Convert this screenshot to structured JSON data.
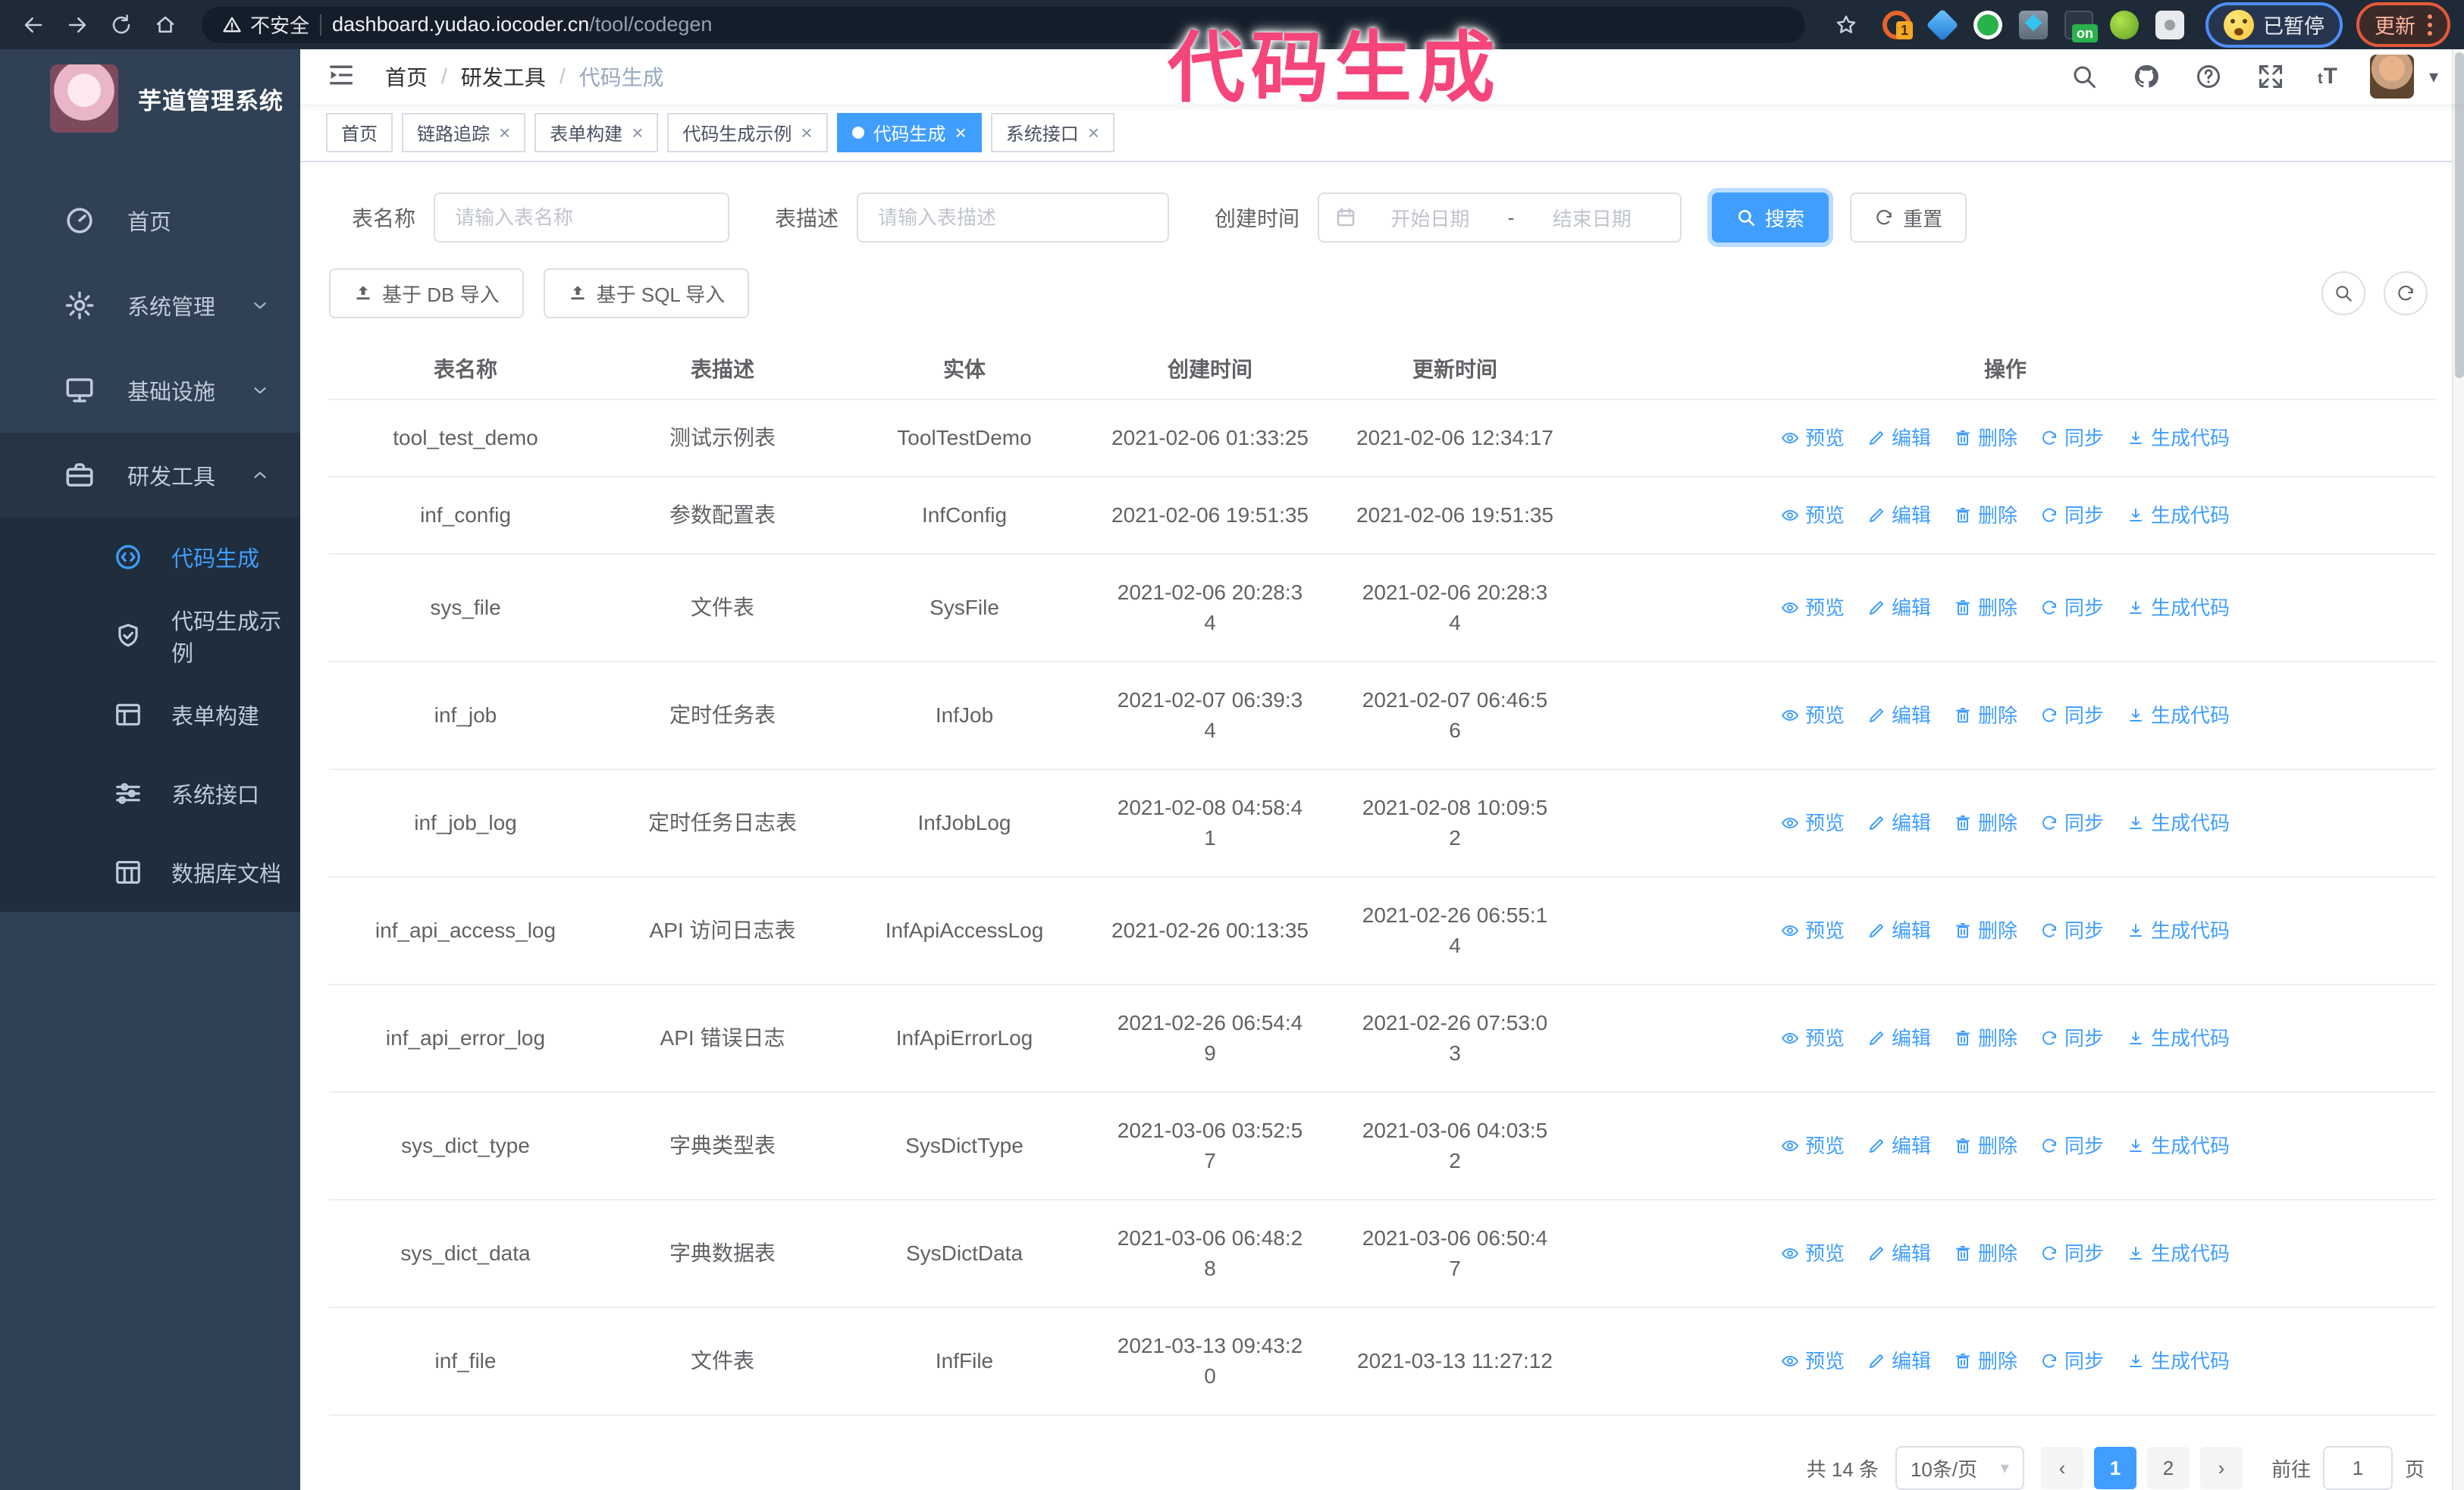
{
  "colors": {
    "accent": "#409eff",
    "sidebar_bg": "#304156",
    "submenu_bg": "#1f2d3d",
    "active_tab_bg": "#409eff",
    "watermark_pink": "#f5457a",
    "browser_bar_bg": "#1f2a38"
  },
  "watermark": "代码生成",
  "browser": {
    "security_warning": "不安全",
    "url_host": "dashboard.yudao.iocoder.cn",
    "url_path": "/tool/codegen",
    "paused_badge": "已暂停",
    "update_button": "更新",
    "extensions": [
      {
        "name": "extension-orange",
        "badge": "1"
      },
      {
        "name": "extension-gem",
        "badge": ""
      },
      {
        "name": "extension-shield",
        "badge": ""
      },
      {
        "name": "extension-panels",
        "badge": ""
      },
      {
        "name": "extension-dark",
        "badge": "on"
      },
      {
        "name": "extension-key",
        "badge": ""
      },
      {
        "name": "extension-puzzle",
        "badge": ""
      }
    ]
  },
  "sidebar": {
    "title": "芋道管理系统",
    "items": [
      {
        "label": "首页",
        "icon": "dashboard",
        "chevron": ""
      },
      {
        "label": "系统管理",
        "icon": "gear",
        "chevron": "down"
      },
      {
        "label": "基础设施",
        "icon": "monitor",
        "chevron": "down"
      },
      {
        "label": "研发工具",
        "icon": "toolbox",
        "chevron": "up",
        "open": true
      }
    ],
    "submenu": [
      {
        "label": "代码生成",
        "icon": "code",
        "active": true
      },
      {
        "label": "代码生成示例",
        "icon": "shield"
      },
      {
        "label": "表单构建",
        "icon": "form"
      },
      {
        "label": "系统接口",
        "icon": "sliders"
      },
      {
        "label": "数据库文档",
        "icon": "dbdoc"
      }
    ]
  },
  "header": {
    "breadcrumb": [
      "首页",
      "研发工具",
      "代码生成"
    ]
  },
  "tabs": [
    {
      "label": "首页",
      "closable": false,
      "active": false
    },
    {
      "label": "链路追踪",
      "closable": true,
      "active": false
    },
    {
      "label": "表单构建",
      "closable": true,
      "active": false
    },
    {
      "label": "代码生成示例",
      "closable": true,
      "active": false
    },
    {
      "label": "代码生成",
      "closable": true,
      "active": true
    },
    {
      "label": "系统接口",
      "closable": true,
      "active": false
    }
  ],
  "filters": {
    "name_label": "表名称",
    "name_placeholder": "请输入表名称",
    "desc_label": "表描述",
    "desc_placeholder": "请输入表描述",
    "time_label": "创建时间",
    "start_placeholder": "开始日期",
    "separator": "-",
    "end_placeholder": "结束日期",
    "search_label": "搜索",
    "reset_label": "重置"
  },
  "toolbar": {
    "import_db": "基于 DB 导入",
    "import_sql": "基于 SQL 导入"
  },
  "table": {
    "columns": [
      "表名称",
      "表描述",
      "实体",
      "创建时间",
      "更新时间",
      "操作"
    ],
    "actions": [
      {
        "label": "预览",
        "icon": "eye"
      },
      {
        "label": "编辑",
        "icon": "edit"
      },
      {
        "label": "删除",
        "icon": "delete"
      },
      {
        "label": "同步",
        "icon": "sync"
      },
      {
        "label": "生成代码",
        "icon": "download"
      }
    ],
    "rows": [
      {
        "name": "tool_test_demo",
        "desc": "测试示例表",
        "entity": "ToolTestDemo",
        "created": "2021-02-06 01:33:25",
        "updated": "2021-02-06 12:34:17"
      },
      {
        "name": "inf_config",
        "desc": "参数配置表",
        "entity": "InfConfig",
        "created": "2021-02-06 19:51:35",
        "updated": "2021-02-06 19:51:35"
      },
      {
        "name": "sys_file",
        "desc": "文件表",
        "entity": "SysFile",
        "created": "2021-02-06 20:28:34",
        "created_break": 18,
        "updated": "2021-02-06 20:28:34",
        "updated_break": 18
      },
      {
        "name": "inf_job",
        "desc": "定时任务表",
        "entity": "InfJob",
        "created": "2021-02-07 06:39:34",
        "created_break": 18,
        "updated": "2021-02-07 06:46:56",
        "updated_break": 18
      },
      {
        "name": "inf_job_log",
        "desc": "定时任务日志表",
        "entity": "InfJobLog",
        "created": "2021-02-08 04:58:41",
        "created_break": 18,
        "updated": "2021-02-08 10:09:52",
        "updated_break": 18
      },
      {
        "name": "inf_api_access_log",
        "desc": "API 访问日志表",
        "entity": "InfApiAccessLog",
        "created": "2021-02-26 00:13:35",
        "updated": "2021-02-26 06:55:14",
        "updated_break": 18
      },
      {
        "name": "inf_api_error_log",
        "desc": "API 错误日志",
        "entity": "InfApiErrorLog",
        "created": "2021-02-26 06:54:49",
        "created_break": 18,
        "updated": "2021-02-26 07:53:03",
        "updated_break": 18
      },
      {
        "name": "sys_dict_type",
        "desc": "字典类型表",
        "entity": "SysDictType",
        "created": "2021-03-06 03:52:57",
        "created_break": 18,
        "updated": "2021-03-06 04:03:52",
        "updated_break": 18
      },
      {
        "name": "sys_dict_data",
        "desc": "字典数据表",
        "entity": "SysDictData",
        "created": "2021-03-06 06:48:28",
        "created_break": 18,
        "updated": "2021-03-06 06:50:47",
        "updated_break": 18
      },
      {
        "name": "inf_file",
        "desc": "文件表",
        "entity": "InfFile",
        "created": "2021-03-13 09:43:20",
        "created_break": 18,
        "updated": "2021-03-13 11:27:12"
      }
    ]
  },
  "pagination": {
    "total": "共 14 条",
    "page_size": "10条/页",
    "pages": [
      {
        "label": "1",
        "active": true
      },
      {
        "label": "2",
        "active": false
      }
    ],
    "goto_label": "前往",
    "goto_value": "1",
    "page_suffix": "页"
  }
}
